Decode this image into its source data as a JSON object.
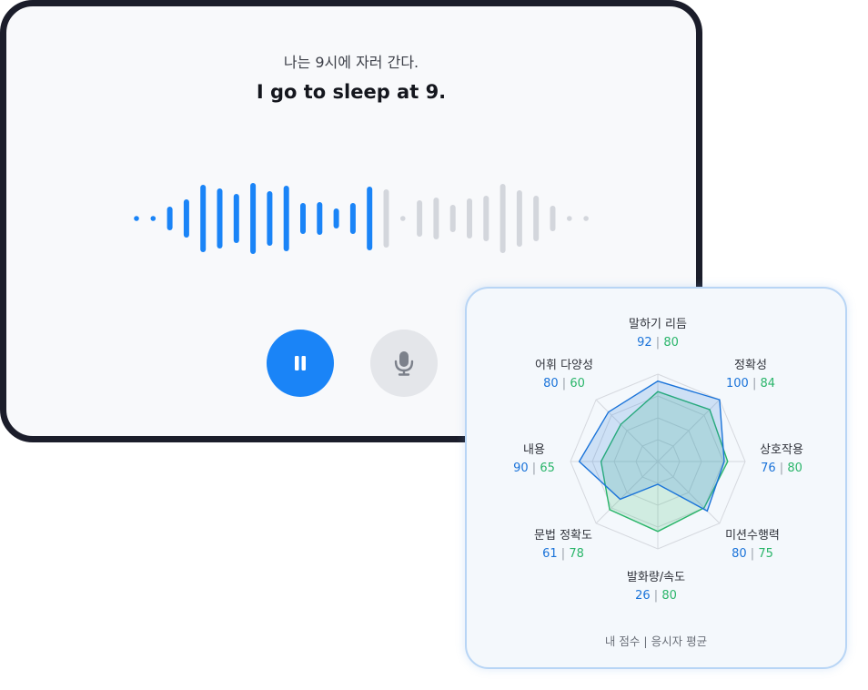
{
  "prompt": {
    "korean_sentence": "나는 9시에 자러 간다.",
    "english_sentence": "I go to sleep at 9."
  },
  "recorder": {
    "played_color": "#1a84f7",
    "remaining_color": "#d3d6dc",
    "pause_icon": "pause-icon",
    "mic_icon": "microphone-icon"
  },
  "radar": {
    "mine_color": "#1a73d9",
    "average_color": "#2ab56a",
    "max": 100,
    "axes": [
      {
        "label": "말하기 리듬",
        "mine": "92",
        "avg": "80"
      },
      {
        "label": "정확성",
        "mine": "100",
        "avg": "84"
      },
      {
        "label": "상호작용",
        "mine": "76",
        "avg": "80"
      },
      {
        "label": "미션수행력",
        "mine": "80",
        "avg": "75"
      },
      {
        "label": "발화량/속도",
        "mine": "26",
        "avg": "80"
      },
      {
        "label": "문법 정확도",
        "mine": "61",
        "avg": "78"
      },
      {
        "label": "내용",
        "mine": "90",
        "avg": "65"
      },
      {
        "label": "어휘 다양성",
        "mine": "80",
        "avg": "60"
      }
    ],
    "legend": {
      "mine_label": "내 점수",
      "separator": "|",
      "average_label": "응시자 평균"
    }
  }
}
